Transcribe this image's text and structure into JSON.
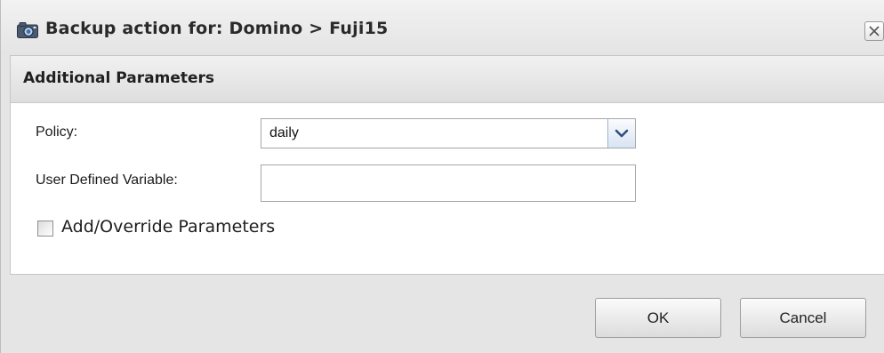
{
  "dialog": {
    "title": "Backup action for: Domino > Fuji15",
    "title_icon": "camera-icon",
    "close_icon": "close-icon"
  },
  "section": {
    "title": "Additional Parameters"
  },
  "form": {
    "policy_label": "Policy:",
    "policy_value": "daily",
    "policy_dropdown_icon": "chevron-down-icon",
    "user_variable_label": "User Defined Variable:",
    "user_variable_value": "",
    "override_label": "Add/Override Parameters",
    "override_checked": false
  },
  "buttons": {
    "ok_label": "OK",
    "cancel_label": "Cancel"
  },
  "colors": {
    "accent": "#4a6fa5",
    "dialog_bg": "#e5e5e5"
  }
}
